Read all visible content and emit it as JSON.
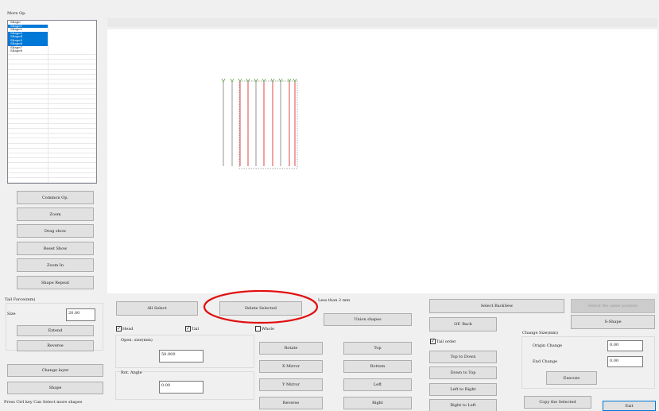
{
  "window": {
    "title": "More Op."
  },
  "shape_list": {
    "header": "Shape",
    "items": [
      {
        "label": "Shape1",
        "selected": true
      },
      {
        "label": "Shape2",
        "selected": false
      },
      {
        "label": "Shape3",
        "selected": true
      },
      {
        "label": "Shape4",
        "selected": true
      },
      {
        "label": "Shape5",
        "selected": true
      },
      {
        "label": "Shape6",
        "selected": true
      },
      {
        "label": "Shape7",
        "selected": false
      },
      {
        "label": "Shape8",
        "selected": false
      }
    ]
  },
  "left_panel": {
    "common_op": "Common Op.",
    "zoom": "Zoom",
    "drag_show": "Drag show",
    "reset_show": "Reset Show",
    "zoom_in": "Zoom In",
    "shape_repeat": "Shape Repeat",
    "tail_force_label": "Tail Force(mm)",
    "size_label": "Size",
    "size_value": "20.00",
    "extend": "Extend",
    "reverse": "Reverse",
    "change_layer": "Change layer",
    "shape": "Shape",
    "hint": "Press Ctrl key  Can Select more shapes"
  },
  "bottom": {
    "all_select": "All Select",
    "delete_selected": "Delete Selected",
    "less_than": "Less than 2 mm",
    "union_shapes": "Union shapes",
    "head_label": "Head",
    "head_checked": true,
    "tail_label": "Tail",
    "tail_checked": true,
    "whole_label": "Whole",
    "whole_checked": false,
    "open_size_label": "Open. size(mm)",
    "open_size_value": "50.000",
    "rot_angle_label": "Rot. Angle",
    "rot_angle_value": "0.00",
    "rotate": "Rotate",
    "x_mirror": "X Mirror",
    "y_mirror": "Y Mirror",
    "reverse": "Reverse",
    "top": "Top",
    "bottom": "Bottom",
    "left": "Left",
    "right": "Right",
    "select_backsew": "Select BackSew",
    "select_same_position": "Select the same position",
    "of_back": "OF. Back",
    "s_shape": "S-Shape",
    "tail_order_label": "Tail order",
    "tail_order_checked": true,
    "top_to_down": "Top to Down",
    "down_to_top": "Down to Top",
    "left_to_right": "Left to Right",
    "right_to_left": "Right to Left",
    "change_size_label": "Change Size(mm)",
    "origin_change_label": "Origin Change",
    "origin_change_value": "0.00",
    "end_change_label": "End Change",
    "end_change_value": "0.00",
    "execute": "Execute",
    "copy_selected": "Copy the Selected",
    "exit": "Exit"
  },
  "annotation": {
    "color": "#e01010"
  },
  "canvas_lines": {
    "green": "#5a9a3a",
    "gray": "#8a8a8a",
    "red": "#e03030"
  }
}
